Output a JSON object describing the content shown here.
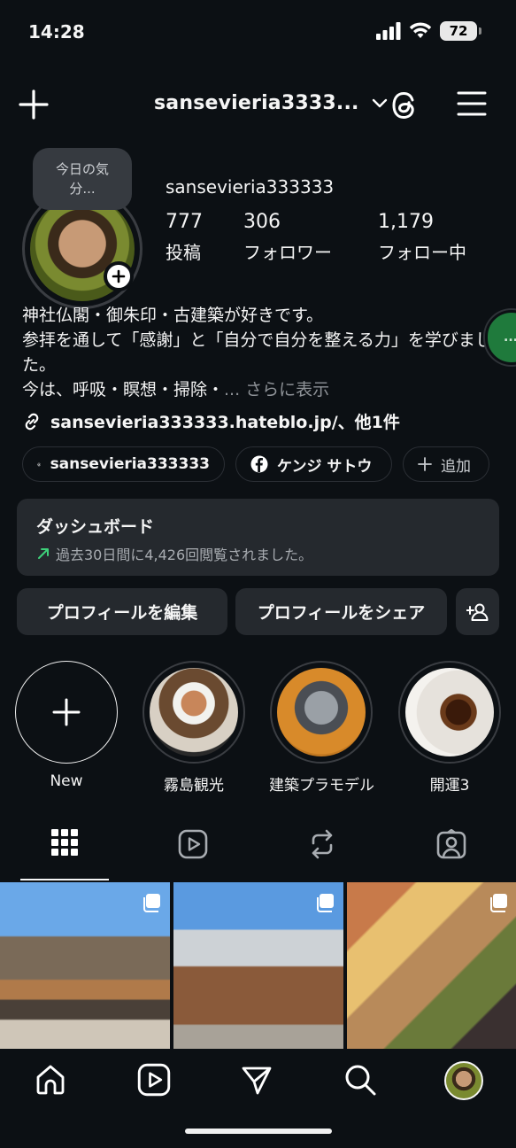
{
  "status_bar": {
    "time": "14:28",
    "battery": "72"
  },
  "header": {
    "username": "sansevieria3333..."
  },
  "profile": {
    "note": "今日の気分...",
    "name": "sansevieria333333",
    "stats": [
      {
        "value": "777",
        "label": "投稿"
      },
      {
        "value": "306",
        "label": "フォロワー"
      },
      {
        "value": "1,179",
        "label": "フォロー中"
      }
    ],
    "bio_line1": "神社仏閣・御朱印・古建築が好きです。",
    "bio_line2": "参拝を通して「感謝」と「自分で自分を整える力」を学びました。",
    "bio_line3": "今は、呼吸・瞑想・掃除・",
    "bio_more": "... さらに表示",
    "link": "sansevieria333333.hateblo.jp/、他1件"
  },
  "pills": {
    "threads": "sansevieria333333",
    "facebook": "ケンジ サトウ",
    "add": "追加"
  },
  "dashboard": {
    "title": "ダッシュボード",
    "subtitle": "過去30日間に4,426回閲覧されました。"
  },
  "buttons": {
    "edit": "プロフィールを編集",
    "share": "プロフィールをシェア"
  },
  "highlights": [
    {
      "label": "New"
    },
    {
      "label": "霧島観光"
    },
    {
      "label": "建築プラモデル"
    },
    {
      "label": "開運3"
    }
  ],
  "side_bubble": "..."
}
